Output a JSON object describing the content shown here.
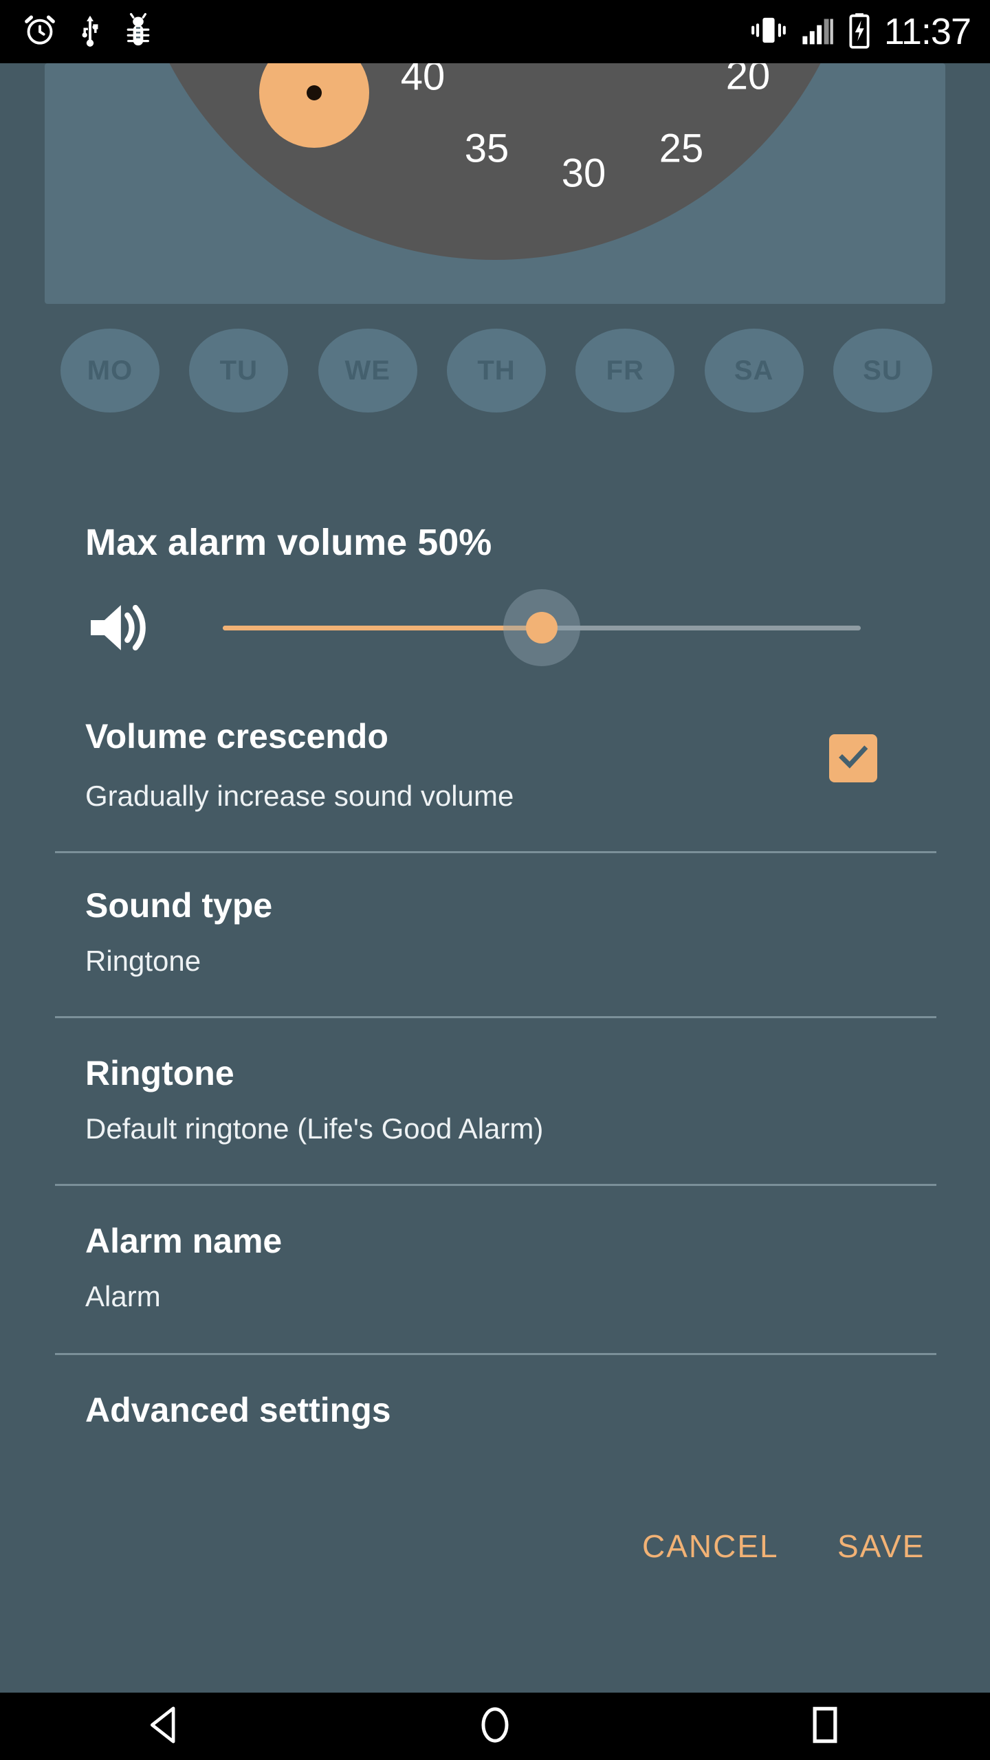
{
  "statusbar": {
    "time": "11:37",
    "icons_left": [
      "alarm-clock-icon",
      "usb-icon",
      "debug-bug-icon"
    ],
    "icons_right": [
      "vibrate-icon",
      "signal-bars-icon",
      "battery-charging-icon"
    ]
  },
  "time_picker": {
    "mode": "minutes",
    "selected_minute": 40,
    "dial_numbers": [
      {
        "value": "20",
        "angle": 120
      },
      {
        "value": "25",
        "angle": 150
      },
      {
        "value": "30",
        "angle": 180
      },
      {
        "value": "35",
        "angle": 210
      },
      {
        "value": "40",
        "angle": 240
      }
    ],
    "hand_angle": 240
  },
  "repeat_days": {
    "items": [
      {
        "label": "MO",
        "selected": false
      },
      {
        "label": "TU",
        "selected": false
      },
      {
        "label": "WE",
        "selected": false
      },
      {
        "label": "TH",
        "selected": false
      },
      {
        "label": "FR",
        "selected": false
      },
      {
        "label": "SA",
        "selected": false
      },
      {
        "label": "SU",
        "selected": false
      }
    ]
  },
  "volume": {
    "title": "Max alarm volume 50%",
    "percent": 50,
    "icon": "speaker-volume-icon"
  },
  "settings": {
    "crescendo": {
      "title": "Volume crescendo",
      "subtitle": "Gradually increase sound volume",
      "checked": true
    },
    "sound_type": {
      "title": "Sound type",
      "value": "Ringtone"
    },
    "ringtone": {
      "title": "Ringtone",
      "value": "Default ringtone (Life's Good Alarm)"
    },
    "alarm_name": {
      "title": "Alarm name",
      "value": "Alarm"
    },
    "advanced": {
      "title": "Advanced settings"
    }
  },
  "actions": {
    "cancel": "CANCEL",
    "save": "SAVE"
  },
  "navbar": {
    "back": "back-icon",
    "home": "home-icon",
    "recents": "recents-icon"
  },
  "colors": {
    "background": "#455a64",
    "accent": "#f2b275",
    "card": "#56707d",
    "dial": "#565656",
    "status_bar": "#000000"
  }
}
